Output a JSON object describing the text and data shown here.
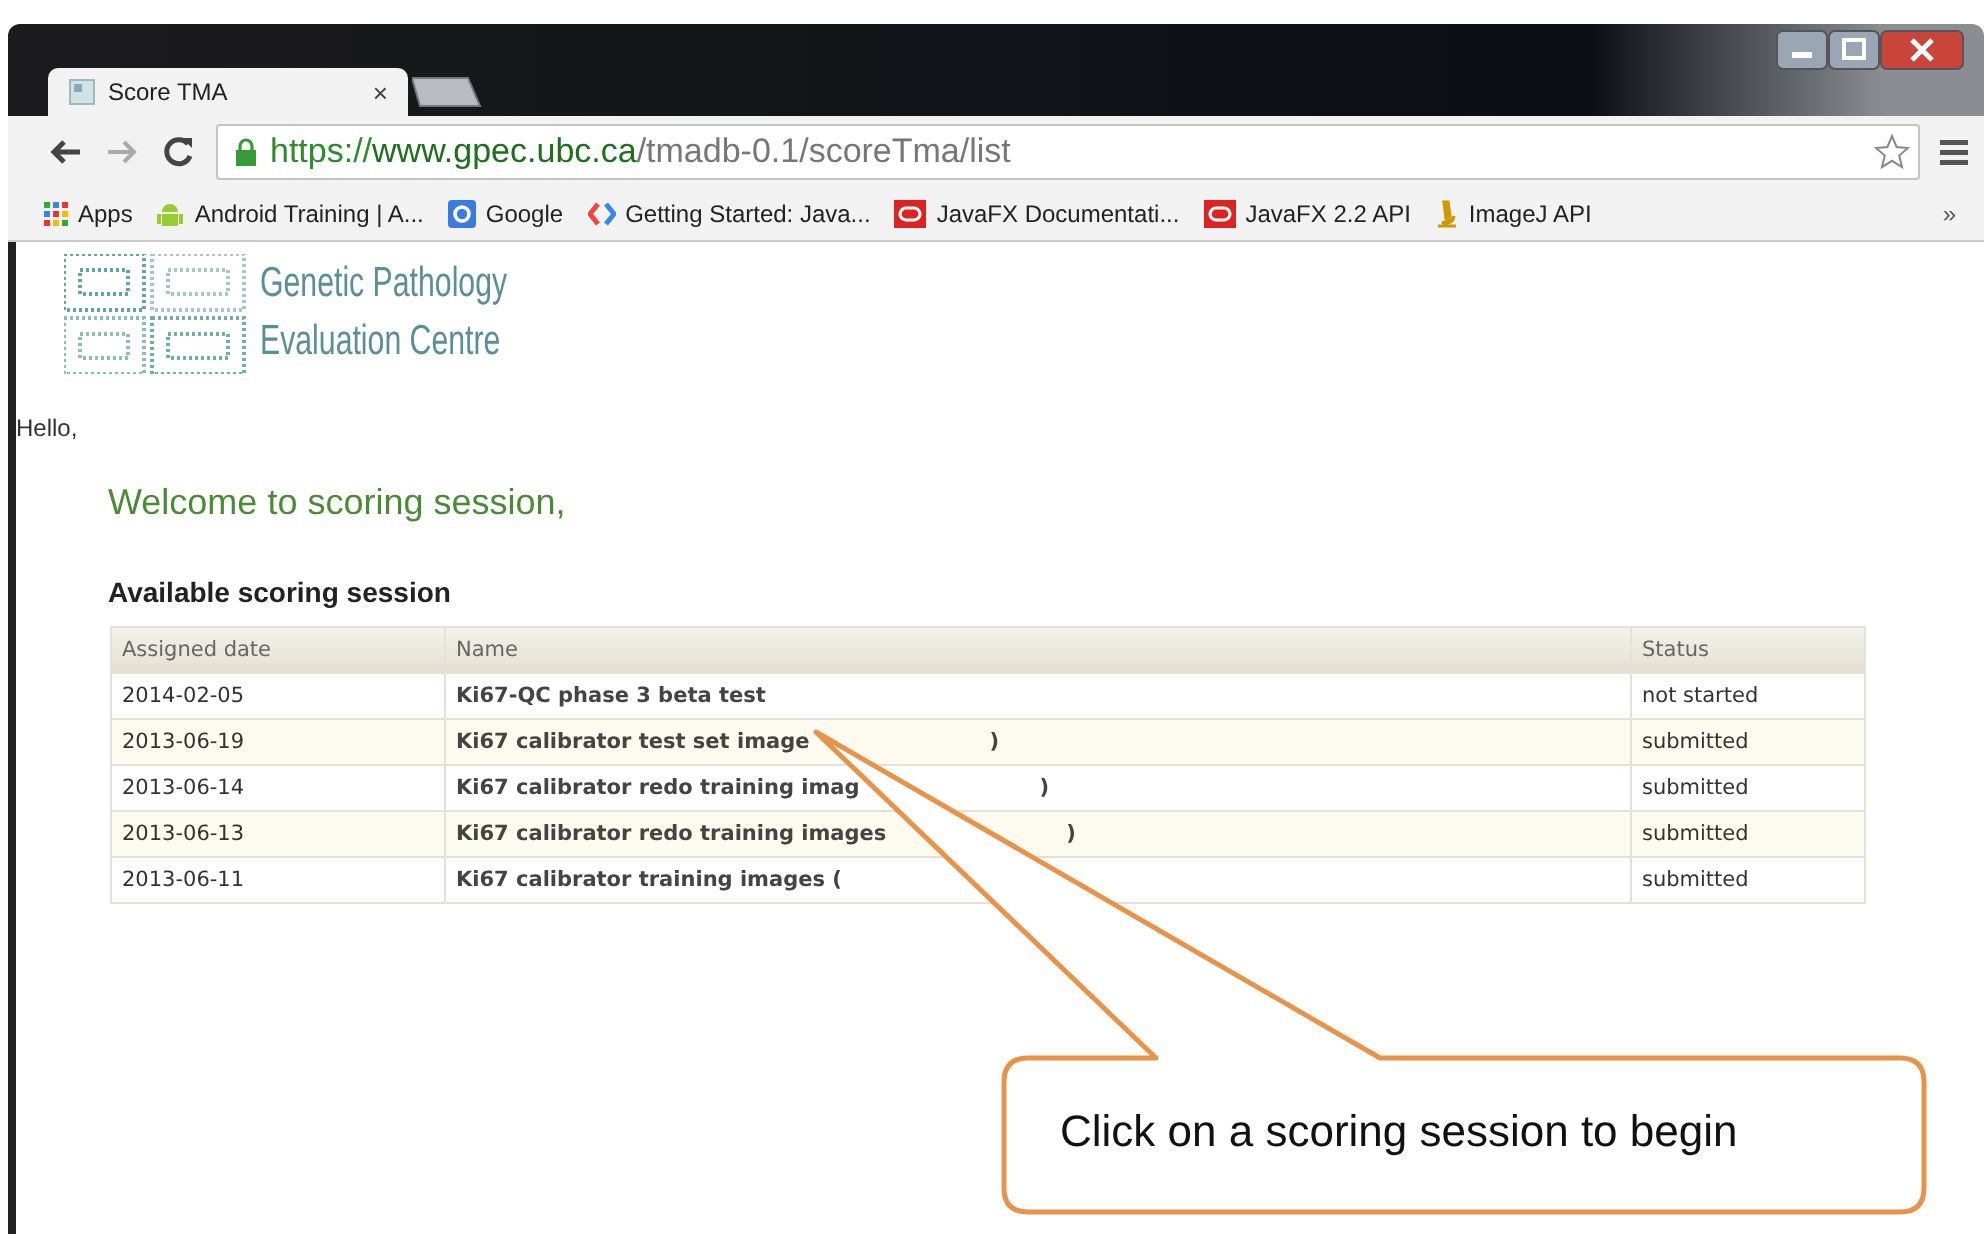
{
  "browser": {
    "tab": {
      "title": "Score TMA",
      "close": "×"
    },
    "url": {
      "scheme": "https://",
      "host": "www.gpec.ubc.ca",
      "path": "/tmadb-0.1/scoreTma/list"
    },
    "bookmarks": [
      {
        "kind": "apps",
        "label": "Apps"
      },
      {
        "kind": "android",
        "label": "Android Training | A..."
      },
      {
        "kind": "google",
        "label": "Google"
      },
      {
        "kind": "gdev",
        "label": "Getting Started: Java..."
      },
      {
        "kind": "oracle",
        "label": "JavaFX Documentati..."
      },
      {
        "kind": "oracle",
        "label": "JavaFX 2.2 API"
      },
      {
        "kind": "imagej",
        "label": "ImageJ API"
      }
    ],
    "bookmarks_overflow": "»"
  },
  "logo": {
    "line_1": "Genetic Pathology",
    "line_2": "Evaluation Centre"
  },
  "greeting": "Hello,",
  "welcome": "Welcome to scoring session,",
  "section_title": "Available scoring session",
  "table": {
    "columns": [
      "Assigned date",
      "Name",
      "Status"
    ],
    "rows": [
      {
        "date": "2014-02-05",
        "name": "Ki67-QC phase 3 beta test",
        "status": "not started"
      },
      {
        "date": "2013-06-19",
        "name": "Ki67 calibrator test set image",
        "name_end": ")",
        "status": "submitted"
      },
      {
        "date": "2013-06-14",
        "name": "Ki67 calibrator redo training imag",
        "name_end": ")",
        "status": "submitted"
      },
      {
        "date": "2013-06-13",
        "name": "Ki67 calibrator redo training images",
        "name_end": ")",
        "status": "submitted"
      },
      {
        "date": "2013-06-11",
        "name": "Ki67 calibrator training images (",
        "status": "submitted"
      }
    ]
  },
  "callout": "Click on a scoring session to begin"
}
